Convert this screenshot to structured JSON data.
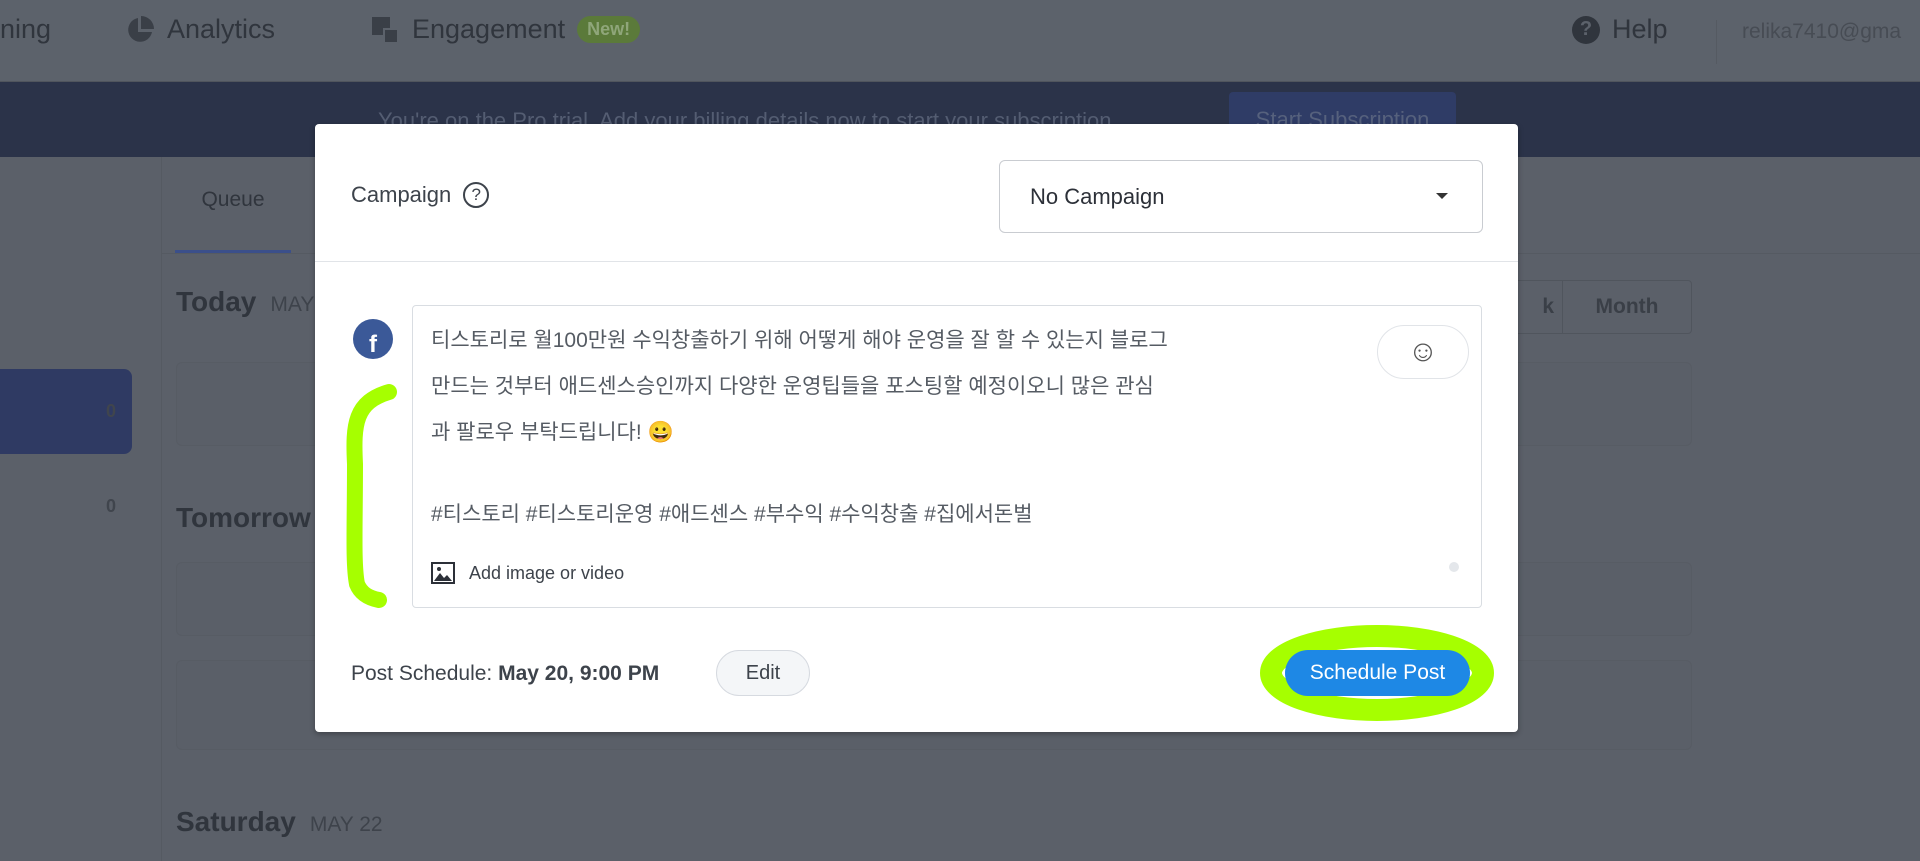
{
  "nav": {
    "items": [
      {
        "label": "ning",
        "icon": "calendar-icon"
      },
      {
        "label": "Analytics",
        "icon": "pie-chart-icon"
      },
      {
        "label": "Engagement",
        "icon": "engagement-icon",
        "badge": "New!"
      }
    ],
    "help": "Help",
    "user": "relika7410@gma"
  },
  "banner": {
    "text": "You're on the Pro trial. Add your billing details now to start your subscription.",
    "button": "Start Subscription"
  },
  "sidebar": {
    "items": [
      {
        "count": "0",
        "active": true
      },
      {
        "count": "0",
        "active": false
      }
    ]
  },
  "content": {
    "tab": "Queue",
    "view_buttons": [
      "k",
      "Month"
    ],
    "days": [
      {
        "title": "Today",
        "date": "MAY"
      },
      {
        "title": "Tomorrow",
        "date": ""
      },
      {
        "title": "Saturday",
        "date": "MAY 22"
      }
    ]
  },
  "modal": {
    "campaign_label": "Campaign",
    "campaign_value": "No Campaign",
    "network": "facebook",
    "post_lines": [
      "티스토리로 월100만원 수익창출하기 위해 어떻게 해야 운영을 잘 할 수 있는지 블로그",
      "만드는 것부터 애드센스승인까지 다양한 운영팁들을 포스팅할 예정이오니 많은 관심",
      "과 팔로우 부탁드립니다! 😀",
      "#티스토리 #티스토리운영 #애드센스 #부수익 #수익창출 #집에서돈벌"
    ],
    "add_media": "Add image or video",
    "schedule_label": "Post Schedule:",
    "schedule_value": "May 20, 9:00 PM",
    "edit": "Edit",
    "submit": "Schedule Post"
  },
  "colors": {
    "accent": "#1e88e5",
    "highlight": "#a6ff00",
    "facebook": "#3b5998"
  }
}
